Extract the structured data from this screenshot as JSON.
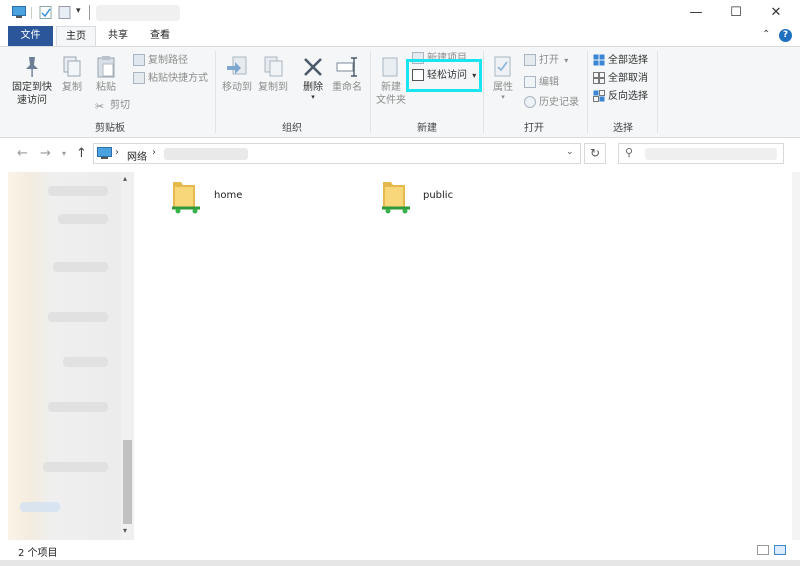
{
  "title_bar": {
    "minimize": "—",
    "maximize": "☐",
    "close": "✕"
  },
  "menu": {
    "tabs": [
      "文件",
      "主页",
      "共享",
      "查看"
    ],
    "collapse": "⌃",
    "help": "?"
  },
  "ribbon": {
    "clipboard": {
      "pin": "固定到快\n速访问",
      "copy": "复制",
      "paste": "粘贴",
      "copy_path": "复制路径",
      "paste_shortcut": "粘贴快捷方式",
      "cut": "剪切",
      "label": "剪贴板"
    },
    "organize": {
      "move_to": "移动到",
      "copy_to": "复制到",
      "delete": "删除",
      "rename": "重命名",
      "label": "组织"
    },
    "new": {
      "new_folder": "新建\n文件夹",
      "new_item": "新建项目",
      "easy_access": "轻松访问",
      "label": "新建"
    },
    "open": {
      "properties": "属性",
      "open": "打开",
      "edit": "编辑",
      "history": "历史记录",
      "label": "打开"
    },
    "select": {
      "select_all": "全部选择",
      "select_none": "全部取消",
      "invert": "反向选择",
      "label": "选择"
    }
  },
  "address": {
    "breadcrumb_root": "网络",
    "sep": "›"
  },
  "content": {
    "items": [
      {
        "name": "home"
      },
      {
        "name": "public"
      }
    ]
  },
  "status": {
    "count": "2 个项目"
  },
  "colors": {
    "file_tab": "#2b579a",
    "highlight": "#19e4f0",
    "ribbon_bg": "#f5f6f7"
  }
}
